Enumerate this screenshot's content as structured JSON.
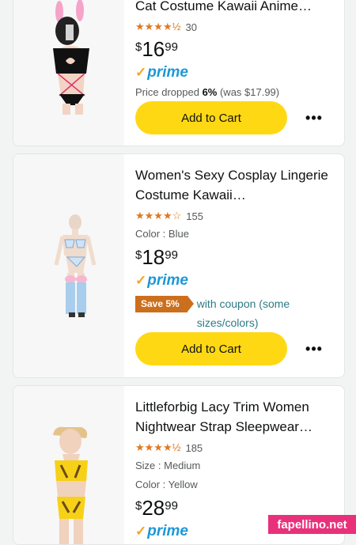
{
  "products": [
    {
      "title": "Cat Costume Kawaii Anime…",
      "stars": "★★★★½",
      "rating_count": "30",
      "price_symbol": "$",
      "price_whole": "16",
      "price_frac": "99",
      "prime_label": "prime",
      "price_drop_prefix": "Price dropped ",
      "price_drop_pct": "6%",
      "price_drop_suffix": " (was $17.99)",
      "cart_label": "Add to Cart",
      "more_label": "•••"
    },
    {
      "title": "Women's Sexy Cosplay Lingerie Costume Kawaii…",
      "stars": "★★★★☆",
      "rating_count": "155",
      "color": "Color : Blue",
      "price_symbol": "$",
      "price_whole": "18",
      "price_frac": "99",
      "prime_label": "prime",
      "coupon_badge": "Save 5%",
      "coupon_text": "with coupon (some sizes/colors)",
      "cart_label": "Add to Cart",
      "more_label": "•••"
    },
    {
      "title": "Littleforbig Lacy Trim Women Nightwear Strap Sleepwear…",
      "stars": "★★★★½",
      "rating_count": "185",
      "size": "Size : Medium",
      "color": "Color : Yellow",
      "price_symbol": "$",
      "price_whole": "28",
      "price_frac": "99",
      "prime_label": "prime"
    }
  ],
  "watermark": "fapellino.net",
  "colors": {
    "cart_button": "#ffd814",
    "stars": "#de7921",
    "prime": "#1c98d6",
    "coupon_badge": "#cc6f1d",
    "coupon_text": "#2d7b85"
  }
}
